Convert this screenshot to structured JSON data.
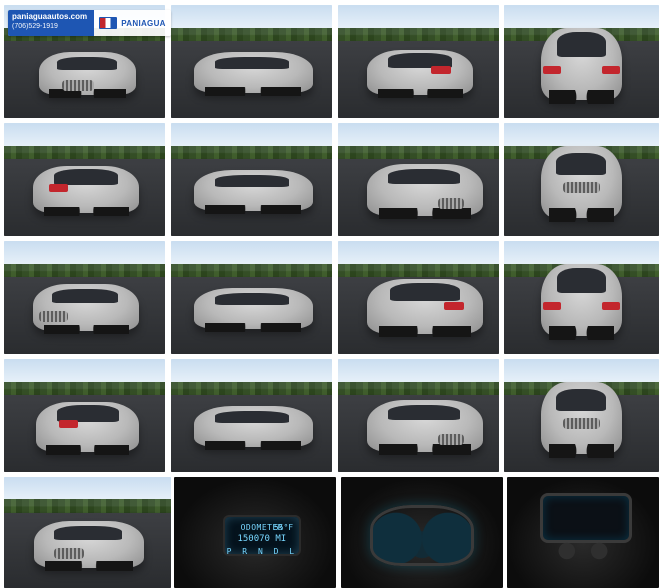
{
  "gallery": {
    "dealer": {
      "domain": "paniaguaautos.com",
      "phone": "(706)529-1919",
      "brand": "PANIAGUA"
    },
    "odometer": {
      "label": "ODOMETER",
      "value": "150070 MI",
      "temp": "55°F",
      "gear": "P R N D L"
    }
  }
}
